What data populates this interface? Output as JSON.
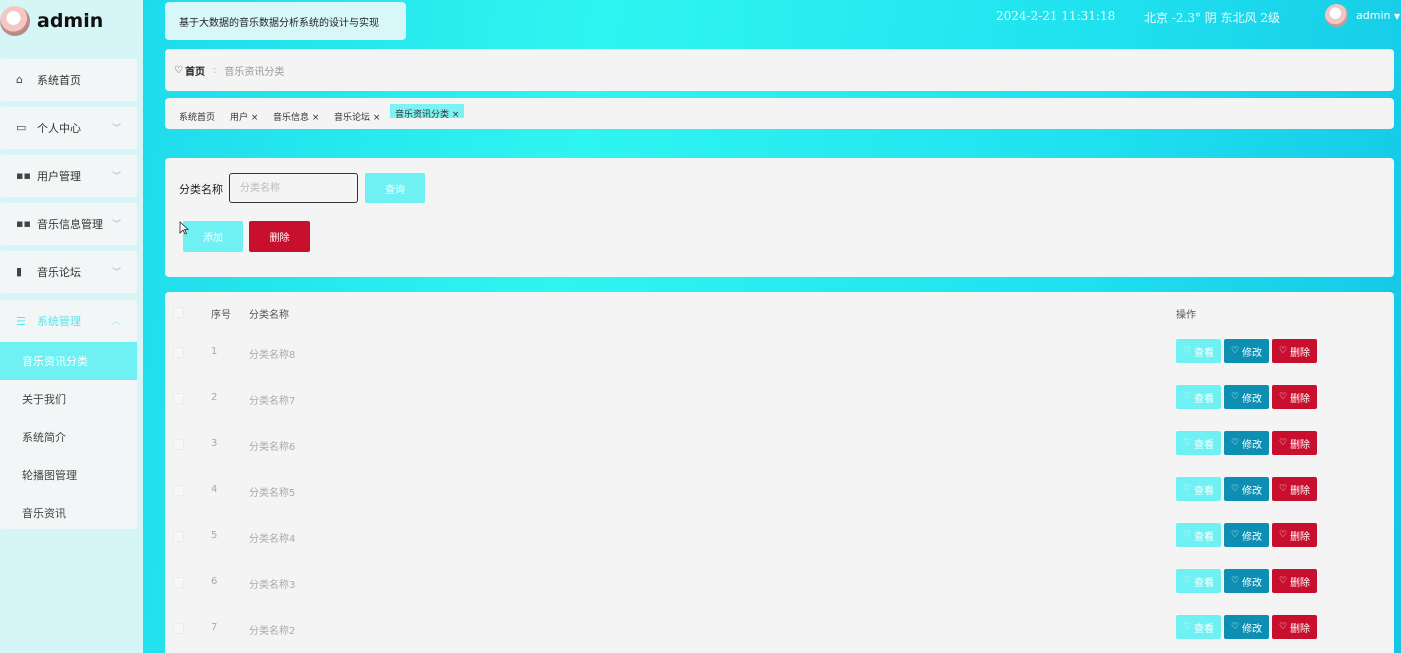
{
  "brand": {
    "name": "admin"
  },
  "header": {
    "system_title": "基于大数据的音乐数据分析系统的设计与实现",
    "datetime": "2024-2-21 11:31:18",
    "weather": "北京 -2.3° 阴 东北风 2级",
    "user": "admin"
  },
  "sidebar": {
    "items": [
      {
        "label": "系统首页",
        "icon": "home-icon"
      },
      {
        "label": "个人中心",
        "icon": "calendar-icon"
      },
      {
        "label": "用户管理",
        "icon": "grid-icon"
      },
      {
        "label": "音乐信息管理",
        "icon": "grid-icon"
      },
      {
        "label": "音乐论坛",
        "icon": "clipboard-icon"
      }
    ],
    "system": {
      "label": "系统管理",
      "sub": [
        "音乐资讯分类",
        "关于我们",
        "系统简介",
        "轮播图管理",
        "音乐资讯"
      ]
    }
  },
  "breadcrumb": {
    "home": "首页",
    "current": "音乐资讯分类"
  },
  "tags": [
    "系统首页",
    "用户 ×",
    "音乐信息 ×",
    "音乐论坛 ×",
    "音乐资讯分类 ×"
  ],
  "search": {
    "label": "分类名称",
    "placeholder": "分类名称",
    "query": "查询",
    "add": "添加",
    "delete": "删除"
  },
  "table": {
    "headers": {
      "index": "序号",
      "name": "分类名称",
      "action": "操作"
    },
    "actions": {
      "view": "查看",
      "edit": "修改",
      "delete": "删除"
    },
    "rows": [
      {
        "index": "1",
        "name": "分类名称8"
      },
      {
        "index": "2",
        "name": "分类名称7"
      },
      {
        "index": "3",
        "name": "分类名称6"
      },
      {
        "index": "4",
        "name": "分类名称5"
      },
      {
        "index": "5",
        "name": "分类名称4"
      },
      {
        "index": "6",
        "name": "分类名称3"
      },
      {
        "index": "7",
        "name": "分类名称2"
      }
    ]
  },
  "colors": {
    "accent": "#6ff1f4",
    "edit": "#0d8fb3",
    "danger": "#c8102e"
  }
}
